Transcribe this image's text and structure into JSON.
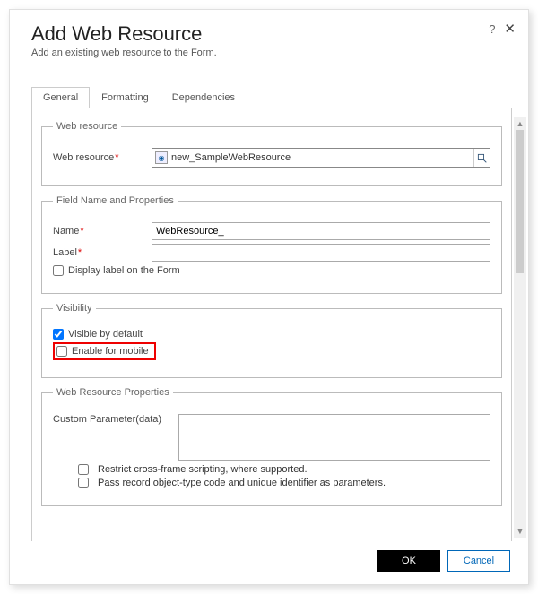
{
  "dialog": {
    "title": "Add Web Resource",
    "subtitle": "Add an existing web resource to the Form.",
    "help_tooltip": "?",
    "close_label": "✕"
  },
  "tabs": {
    "items": [
      {
        "label": "General",
        "active": true
      },
      {
        "label": "Formatting",
        "active": false
      },
      {
        "label": "Dependencies",
        "active": false
      }
    ]
  },
  "groups": {
    "web_resource": {
      "legend": "Web resource",
      "field_label": "Web resource",
      "value": "new_SampleWebResource"
    },
    "field_name": {
      "legend": "Field Name and Properties",
      "name_label": "Name",
      "name_value": "WebResource_",
      "label_label": "Label",
      "label_value": "",
      "display_label_text": "Display label on the Form"
    },
    "visibility": {
      "legend": "Visibility",
      "visible_default": "Visible by default",
      "enable_mobile": "Enable for mobile"
    },
    "wr_props": {
      "legend": "Web Resource Properties",
      "custom_param_label": "Custom Parameter(data)",
      "custom_param_value": "",
      "restrict_xframe": "Restrict cross-frame scripting, where supported.",
      "pass_record": "Pass record object-type code and unique identifier as parameters."
    }
  },
  "buttons": {
    "ok": "OK",
    "cancel": "Cancel"
  }
}
